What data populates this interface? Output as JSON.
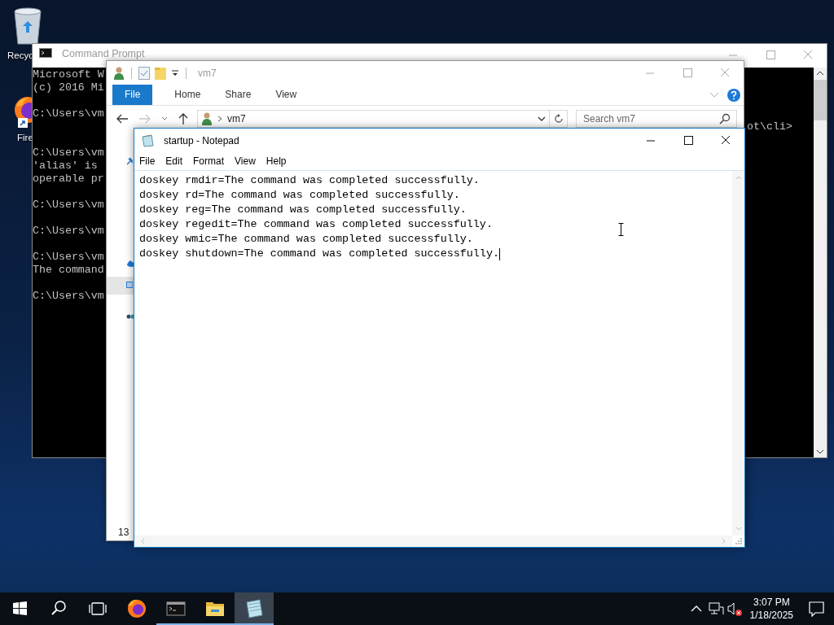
{
  "desktop_icons": [
    {
      "kind": "recycle-bin",
      "label": "Recyc"
    },
    {
      "kind": "firefox",
      "label": "Fire"
    }
  ],
  "command_prompt": {
    "title": "Command Prompt",
    "active": false,
    "blocks": [
      [
        {
          "text": "Microsoft W"
        },
        {
          "text": "(c) 2016 Mi"
        }
      ],
      [
        {
          "text": "C:\\Users\\vm"
        },
        {
          "tail": "ot\\cli>"
        }
      ],
      [
        {
          "text": "C:\\Users\\vm"
        },
        {
          "text": "'alias' is"
        },
        {
          "text": "operable pr"
        }
      ],
      [
        {
          "text": "C:\\Users\\vm"
        }
      ],
      [
        {
          "text": "C:\\Users\\vm"
        }
      ],
      [
        {
          "text": "C:\\Users\\vm"
        },
        {
          "text": "The command"
        }
      ],
      [
        {
          "text": "C:\\Users\\vm"
        }
      ]
    ]
  },
  "explorer": {
    "title": "vm7",
    "active": false,
    "ribbon_tabs": [
      {
        "label": "File",
        "selected": true
      },
      {
        "label": "Home",
        "selected": false
      },
      {
        "label": "Share",
        "selected": false
      },
      {
        "label": "View",
        "selected": false
      }
    ],
    "address": {
      "crumb": "vm7"
    },
    "search": {
      "placeholder": "Search vm7"
    },
    "status_text": "13"
  },
  "notepad": {
    "title": "startup - Notepad",
    "active": true,
    "menu": [
      "File",
      "Edit",
      "Format",
      "View",
      "Help"
    ],
    "lines": [
      "doskey rmdir=The command was completed successfully.",
      "doskey rd=The command was completed successfully.",
      "doskey reg=The command was completed successfully.",
      "doskey regedit=The command was completed successfully.",
      "doskey wmic=The command was completed successfully.",
      "doskey shutdown=The command was completed successfully."
    ]
  },
  "taskbar": {
    "apps": [
      {
        "kind": "firefox",
        "open": false,
        "active": false
      },
      {
        "kind": "console",
        "open": true,
        "active": false
      },
      {
        "kind": "folder",
        "open": true,
        "active": false
      },
      {
        "kind": "notepad",
        "open": true,
        "active": true
      }
    ],
    "time": "3:07 PM",
    "date": "1/18/2025"
  }
}
